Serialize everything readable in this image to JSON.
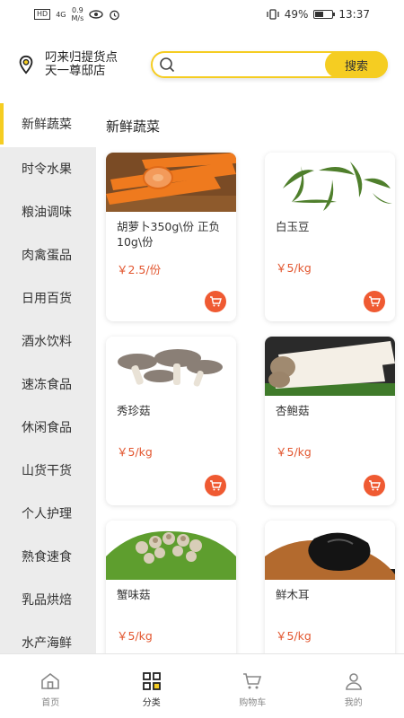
{
  "status_bar": {
    "hd": "HD",
    "network": "4G",
    "speed_value": "0.9",
    "speed_unit": "M/s",
    "battery_text": "49%",
    "battery_level": 0.49,
    "time": "13:37"
  },
  "header": {
    "store_line1": "叼来归提货点",
    "store_line2": "天一尊邸店",
    "search_placeholder": "",
    "search_button": "搜索"
  },
  "sidebar": {
    "items": [
      {
        "label": "新鲜蔬菜",
        "active": true
      },
      {
        "label": "时令水果"
      },
      {
        "label": "粮油调味"
      },
      {
        "label": "肉禽蛋品"
      },
      {
        "label": "日用百货"
      },
      {
        "label": "酒水饮料"
      },
      {
        "label": "速冻食品"
      },
      {
        "label": "休闲食品"
      },
      {
        "label": "山货干货"
      },
      {
        "label": "个人护理"
      },
      {
        "label": "熟食速食"
      },
      {
        "label": "乳品烘焙"
      },
      {
        "label": "水产海鲜"
      }
    ]
  },
  "content": {
    "section_title": "新鲜蔬菜",
    "products": [
      {
        "name": "胡萝卜350g\\份 正负10g\\份",
        "price": "￥2.5/份",
        "image": "carrot-image"
      },
      {
        "name": "白玉豆",
        "price": "￥5/kg",
        "image": "bean-image"
      },
      {
        "name": "秀珍菇",
        "price": "￥5/kg",
        "image": "oyster-mushroom-image"
      },
      {
        "name": "杏鲍菇",
        "price": "￥5/kg",
        "image": "king-oyster-image"
      },
      {
        "name": "蟹味菇",
        "price": "￥5/kg",
        "image": "crab-mushroom-image"
      },
      {
        "name": "鲜木耳",
        "price": "￥5/kg",
        "image": "wood-ear-image"
      }
    ]
  },
  "tabbar": {
    "items": [
      {
        "label": "首页",
        "icon": "home-icon"
      },
      {
        "label": "分类",
        "icon": "category-icon",
        "active": true
      },
      {
        "label": "购物车",
        "icon": "cart-icon"
      },
      {
        "label": "我的",
        "icon": "user-icon"
      }
    ]
  },
  "colors": {
    "accent": "#f5cd22",
    "price": "#e2562f",
    "cart_button": "#ef5a32"
  }
}
